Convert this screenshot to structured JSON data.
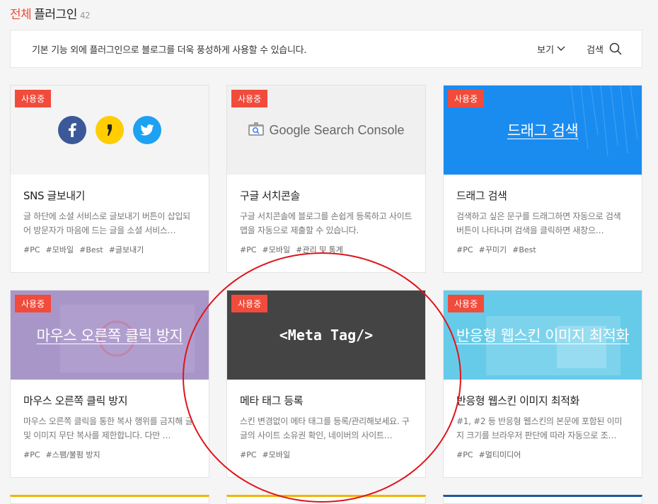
{
  "header": {
    "accent": "전체",
    "title": "플러그인",
    "count": "42"
  },
  "info_bar": {
    "description": "기본 기능 외에 플러그인으로 블로그를 더욱 풍성하게 사용할 수 있습니다.",
    "view_label": "보기",
    "search_label": "검색"
  },
  "badge_label": "사용중",
  "cards": [
    {
      "name": "SNS 글보내기",
      "description": "글 하단에 소셜 서비스로 글보내기 버튼이 삽입되어 방문자가 마음에 드는 글을 소셜 서비스…",
      "tags": [
        "#PC",
        "#모바일",
        "#Best",
        "#글보내기"
      ]
    },
    {
      "name": "구글 서치콘솔",
      "thumb_text": "Google Search Console",
      "description": "구글 서치콘솔에 블로그를 손쉽게 등록하고 사이트맵을 자동으로 제출할 수 있습니다.",
      "tags": [
        "#PC",
        "#모바일",
        "#관리 및 통계"
      ]
    },
    {
      "name": "드래그 검색",
      "thumb_text": "드래그 검색",
      "description": "검색하고 싶은 문구를 드래그하면 자동으로 검색 버튼이 나타나며 검색을 클릭하면 새창으…",
      "tags": [
        "#PC",
        "#꾸미기",
        "#Best"
      ]
    },
    {
      "name": "마우스 오른쪽 클릭 방지",
      "thumb_text": "마우스 오른쪽 클릭 방지",
      "description": "마우스 오른쪽 클릭을 통한 복사 행위를 금지해 글 및 이미지 무단 복사를 제한합니다. 다만 …",
      "tags": [
        "#PC",
        "#스팸/불펌 방지"
      ]
    },
    {
      "name": "메타 태그 등록",
      "thumb_text": "<Meta Tag/>",
      "description": "스킨 변경없이 메타 태그를 등록/관리해보세요. 구글의 사이트 소유권 확인, 네이버의 사이트…",
      "tags": [
        "#PC",
        "#모바일"
      ]
    },
    {
      "name": "반응형 웹스킨 이미지 최적화",
      "thumb_text": "반응형 웹스킨 이미지 최적화",
      "description": "#1, #2 등 반응형 웹스킨의 본문에 포함된 이미지 크기를 브라우저 판단에 따라 자동으로 조…",
      "tags": [
        "#PC",
        "#멀티미디어"
      ]
    }
  ],
  "colors": {
    "accent": "#f04a34",
    "badge": "#f14b3b",
    "annotation": "#e0141b"
  }
}
